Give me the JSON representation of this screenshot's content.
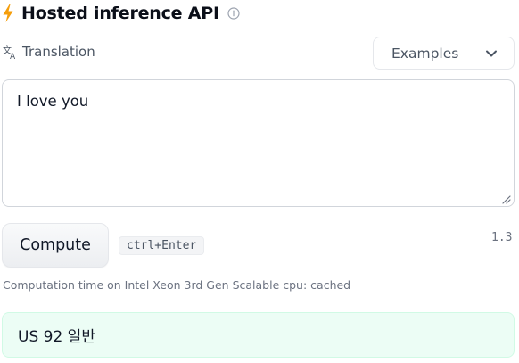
{
  "header": {
    "title": "Hosted inference API",
    "bolt_icon": "lightning-bolt-icon",
    "info_icon": "info-icon",
    "accent_color": "#f59e0b"
  },
  "task": {
    "icon": "translation-icon",
    "label": "Translation"
  },
  "examples": {
    "label": "Examples",
    "icon": "chevron-down-icon"
  },
  "input": {
    "value": "I love you"
  },
  "actions": {
    "compute_label": "Compute",
    "shortcut": "ctrl+Enter",
    "version": "1.3"
  },
  "timing": {
    "text": "Computation time on Intel Xeon 3rd Gen Scalable cpu: cached"
  },
  "output": {
    "text": "US 92 일반",
    "background_color": "#ecfdf5"
  }
}
